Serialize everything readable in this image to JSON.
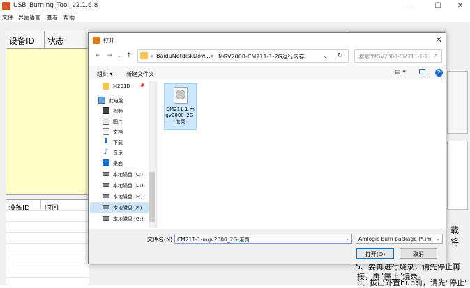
{
  "app": {
    "title": "USB_Burning_Tool_v2.1.6.8",
    "menu": [
      "文件",
      "界面语言",
      "查看",
      "帮助"
    ],
    "window_controls": [
      "—",
      "☐",
      "✕"
    ],
    "table_top_headers": [
      "设备ID",
      "状态"
    ],
    "table_bottom_headers": [
      "设备ID",
      "时间"
    ],
    "side_text_1": "载",
    "side_text_2": "将",
    "instructions": [
      "5、要再进行烧录，请先停止再",
      "接，再\"停止\"烧录。",
      "6、拔出外置hub前，请先\"停止\""
    ]
  },
  "dialog": {
    "title": "打开",
    "close_glyph": "✕",
    "nav": {
      "back": "←",
      "forward": "→",
      "dropdown": "⌄",
      "up": "↑"
    },
    "address": {
      "prefix": "«",
      "segments": [
        "BaiduNetdiskDow...",
        "MGV2000-CM211-1-2G运行内存"
      ],
      "separator": ">",
      "dropdown": "⌄",
      "refresh": "↻"
    },
    "search_placeholder": "搜索\"MGV2000-CM211-1-2...",
    "toolbar": {
      "organize": "组织 ▾",
      "new_folder": "新建文件夹",
      "view": "▤ ▾"
    },
    "nav_items": [
      {
        "label": "M201D",
        "icon": "folder-icon",
        "pin": "📌"
      },
      {
        "label": "此电脑",
        "icon": "computer-icon"
      },
      {
        "label": "视频",
        "icon": "video-icon"
      },
      {
        "label": "图片",
        "icon": "image-icon"
      },
      {
        "label": "文档",
        "icon": "document-icon"
      },
      {
        "label": "下载",
        "icon": "download-icon"
      },
      {
        "label": "音乐",
        "icon": "music-icon"
      },
      {
        "label": "桌面",
        "icon": "desktop-icon"
      },
      {
        "label": "本地磁盘 (C:)",
        "icon": "drive-icon"
      },
      {
        "label": "本地磁盘 (D:)",
        "icon": "drive-icon"
      },
      {
        "label": "本地磁盘 (E:)",
        "icon": "drive-icon"
      },
      {
        "label": "本地磁盘 (F:)",
        "icon": "drive-icon",
        "selected": true
      },
      {
        "label": "本地磁盘 (G:)",
        "icon": "drive-icon"
      }
    ],
    "files": [
      {
        "name": "CM211-1-mgv2000_2G-港页"
      }
    ],
    "filename_label": "文件名(N):",
    "filename_value": "CM211-1-mgv2000_2G-港页",
    "filetype_value": "Amlogic burn package (*.img)",
    "open_label": "打开(O)",
    "cancel_label": "取消",
    "colors": {
      "accent": "#0078d7",
      "selection": "#cce8ff"
    }
  }
}
